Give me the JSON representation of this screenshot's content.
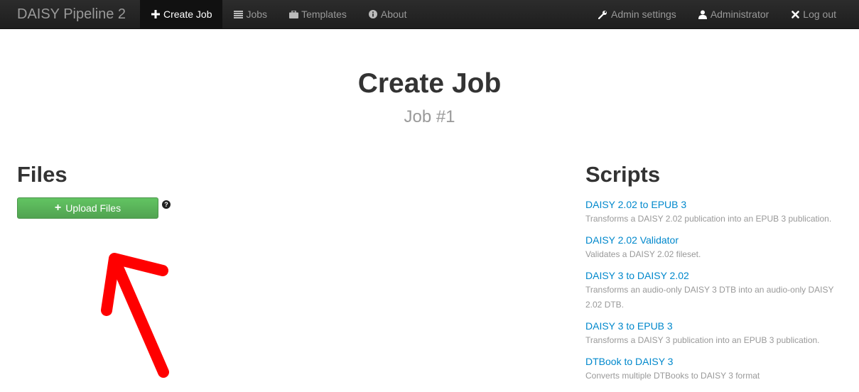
{
  "navbar": {
    "brand": "DAISY Pipeline 2",
    "left_items": [
      {
        "label": "Create Job",
        "icon": "plus-icon",
        "active": true
      },
      {
        "label": "Jobs",
        "icon": "list-icon",
        "active": false
      },
      {
        "label": "Templates",
        "icon": "briefcase-icon",
        "active": false
      },
      {
        "label": "About",
        "icon": "info-icon",
        "active": false
      }
    ],
    "right_items": [
      {
        "label": "Admin settings",
        "icon": "wrench-icon"
      },
      {
        "label": "Administrator",
        "icon": "user-icon"
      },
      {
        "label": "Log out",
        "icon": "close-icon"
      }
    ]
  },
  "header": {
    "title": "Create Job",
    "subtitle": "Job #1"
  },
  "files": {
    "heading": "Files",
    "upload_label": "Upload Files",
    "help_icon": "question-icon"
  },
  "scripts": {
    "heading": "Scripts",
    "items": [
      {
        "name": "DAISY 2.02 to EPUB 3",
        "description": "Transforms a DAISY 2.02 publication into an EPUB 3 publication."
      },
      {
        "name": "DAISY 2.02 Validator",
        "description": "Validates a DAISY 2.02 fileset."
      },
      {
        "name": "DAISY 3 to DAISY 2.02",
        "description": "Transforms an audio-only DAISY 3 DTB into an audio-only DAISY 2.02 DTB."
      },
      {
        "name": "DAISY 3 to EPUB 3",
        "description": "Transforms a DAISY 3 publication into an EPUB 3 publication."
      },
      {
        "name": "DTBook to DAISY 3",
        "description": "Converts multiple DTBooks to DAISY 3 format"
      }
    ]
  },
  "colors": {
    "navbar_bg": "#222222",
    "link": "#0088cc",
    "success": "#5bb75b",
    "annotation_arrow": "#ff0000"
  }
}
